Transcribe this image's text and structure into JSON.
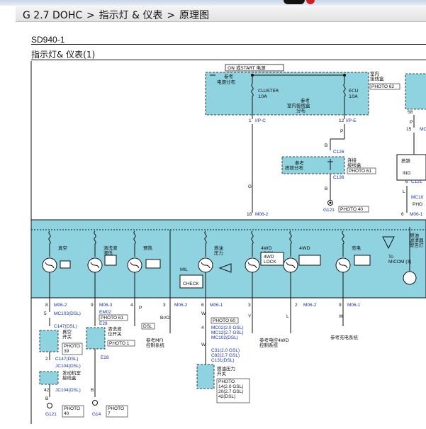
{
  "breadcrumb": {
    "model": "G 2.7 DOHC",
    "sep": ">",
    "section": "指示灯 & 仪表",
    "page": "原理图"
  },
  "diagram": {
    "code": "SD940-1",
    "title": "指示灯& 仪表(1)",
    "top_box_title": "ON 或START 电源",
    "ref_power": "参考\n电源分布",
    "cluster_fuse": "CLUSTER\n10A",
    "ecu_fuse": "ECU\n10A",
    "ref_junction": "参考\n室内接线盒\n分布",
    "indoor_box": "室内\n接线盒",
    "photo62": "PHOTO 62",
    "pin1": "1",
    "ip_c": "I/P-C",
    "pin12": "12",
    "ip_e": "I/P-E",
    "c126": "C126",
    "c136": "C136",
    "ref_ground_dist": "参考\n搭铁分布",
    "connector_box": "连接\n接线盒",
    "photo61": "PHOTO 61",
    "g121": "G121",
    "photo40": "PHOTO 40",
    "ind_box": "IND",
    "c121": "C121",
    "mc10": "MC10",
    "pho": "PHO",
    "m06_1": "M06-1",
    "m06_2": "M06-2",
    "wire_g": "G",
    "wire_p": "P",
    "wire_b": "B",
    "wire_l": "L",
    "pin18": "18",
    "pin58": "58",
    "pin15": "15",
    "pin6": "6",
    "lamps": [
      "真空",
      "清洗液\n液低",
      "预热",
      "燃油\n压力",
      "4WD\nLOCK",
      "4WD",
      "充电"
    ],
    "lock_label": "4WD\nLOCK",
    "mil_label": "MIL",
    "check_label": "CHECK",
    "micom_label": "To\nMICOM (3)",
    "warning_label": "燃油\n滤清器\n警告灯",
    "bottom": {
      "m06_2": "M06-2",
      "m06_3": "M06-3",
      "mc103": "MC103(DSL)",
      "em02": "EM02",
      "photo61": "PHOTO 61",
      "e28": "E28",
      "c147": "C147(DSL)",
      "vacuum_switch": "真空\n开关",
      "photo39": "PHOTO\n39",
      "washer_switch": "清洗液\n位开关",
      "photo1": "PHOTO 1",
      "c147b": "C147(DSL)",
      "e28b": "E28",
      "jc104": "JC104(DSL)",
      "engine_box": "发动机室\n接线盒",
      "jc104b": "JC104(DSL)",
      "g121": "G121",
      "photo40": "PHOTO\n40",
      "g14": "G14",
      "photo7": "PHOTO\n7",
      "dsl": "DSL",
      "p": "P",
      "br_o": "Br/O",
      "ref_mfi": "参考MFI\n控制系统",
      "m06_2b": "M06-2",
      "m06_1": "M06-1",
      "photo60": "PHOTO 60",
      "mc02": "MC02(2.0 GSL)",
      "mc12": "MC12(2.7 GSL)",
      "mc102": "MC102(DSL)",
      "c31": "C31(2.0 GSL)",
      "c82": "C82(2.7 GSL)",
      "c131": "C131(DSL)",
      "oil_switch": "燃油压力\n开关",
      "photo_oil": "PHOTO\n14(2.0 GSL)\n20(2.7 GSL)\n42(DSL)",
      "y": "Y",
      "ref_4wd": "参考电控4WD\n控制系统",
      "m06_2c": "M06-2",
      "w": "W",
      "ref_charge": "参考充电系统",
      "m06_1b": "M06-1"
    }
  },
  "colors": {
    "panel": "#8fd3e0",
    "link": "#1a33a8",
    "red_logo": "#d21e1e"
  }
}
